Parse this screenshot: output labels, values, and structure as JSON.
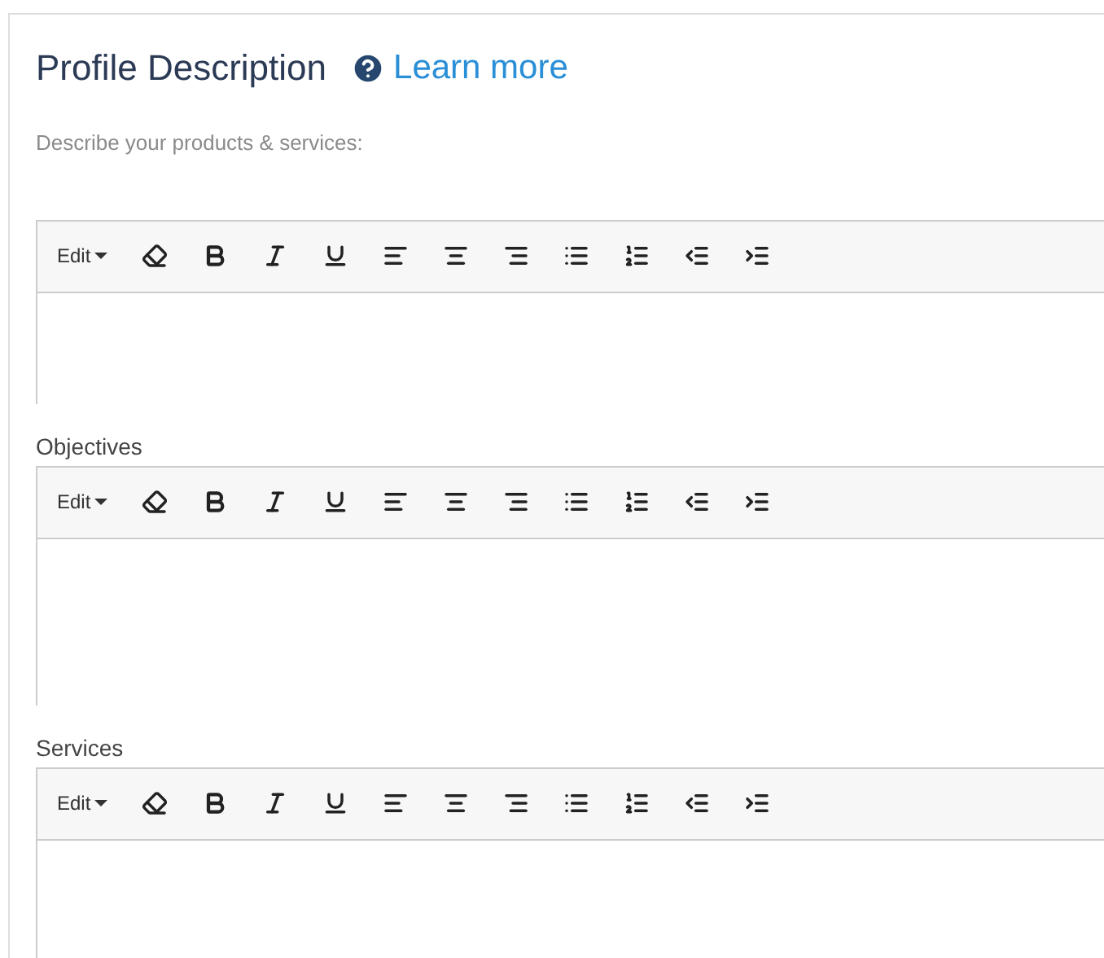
{
  "title": "Profile Description",
  "help_link": "Learn more",
  "editors": [
    {
      "heading": "Describe your products & services:",
      "kind": "hint",
      "menu": "Edit"
    },
    {
      "heading": "Objectives",
      "kind": "label",
      "menu": "Edit"
    },
    {
      "heading": "Services",
      "kind": "label",
      "menu": "Edit"
    }
  ]
}
